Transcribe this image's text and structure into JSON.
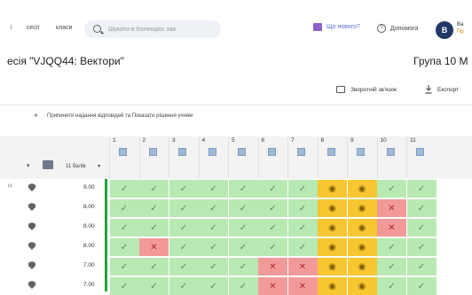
{
  "nav": {
    "item1": "і",
    "item2": "сесії",
    "item3": "класи"
  },
  "search": {
    "placeholder": "Шукати в Колекціях зав"
  },
  "header": {
    "whats_new": "Що нового?",
    "help": "Допомога",
    "avatar_letter": "B",
    "user_line1": "Ва",
    "user_line2": "Пр"
  },
  "page": {
    "title": "есія \"VJQQ44: Вектори\"",
    "group": "Група 10 М"
  },
  "toolbar": {
    "feedback": "Зворотній зв'язок",
    "export": "Експорт"
  },
  "stop_text": "Припинити надання відповідей та Показати рішення учням",
  "table": {
    "score_header": "11 балів",
    "columns": [
      "1",
      "2",
      "3",
      "4",
      "5",
      "6",
      "7",
      "8",
      "9",
      "10",
      "11"
    ],
    "rows": [
      {
        "left": "Н",
        "score": "9.00",
        "cells": [
          "ok",
          "ok",
          "ok",
          "ok",
          "ok",
          "ok",
          "ok",
          "eye",
          "eye",
          "ok",
          "ok"
        ]
      },
      {
        "left": "",
        "score": "8.00",
        "cells": [
          "ok",
          "ok",
          "ok",
          "ok",
          "ok",
          "ok",
          "ok",
          "eye",
          "eye",
          "bad",
          "ok"
        ]
      },
      {
        "left": "",
        "score": "8.00",
        "cells": [
          "ok",
          "ok",
          "ok",
          "ok",
          "ok",
          "ok",
          "ok",
          "eye",
          "eye",
          "bad",
          "ok"
        ]
      },
      {
        "left": "",
        "score": "8.00",
        "cells": [
          "ok",
          "bad",
          "ok",
          "ok",
          "ok",
          "ok",
          "ok",
          "eye",
          "eye",
          "ok",
          "ok"
        ]
      },
      {
        "left": "",
        "score": "7.00",
        "cells": [
          "ok",
          "ok",
          "ok",
          "ok",
          "ok",
          "bad",
          "bad",
          "eye",
          "eye",
          "ok",
          "ok"
        ]
      },
      {
        "left": "",
        "score": "7.00",
        "cells": [
          "ok",
          "ok",
          "ok",
          "ok",
          "ok",
          "bad",
          "bad",
          "eye",
          "eye",
          "ok",
          "ok"
        ]
      }
    ]
  },
  "colors": {
    "ok": "#b8e9b2",
    "bad": "#f29a9a",
    "eye": "#f7c631",
    "accent": "#22a33a"
  }
}
